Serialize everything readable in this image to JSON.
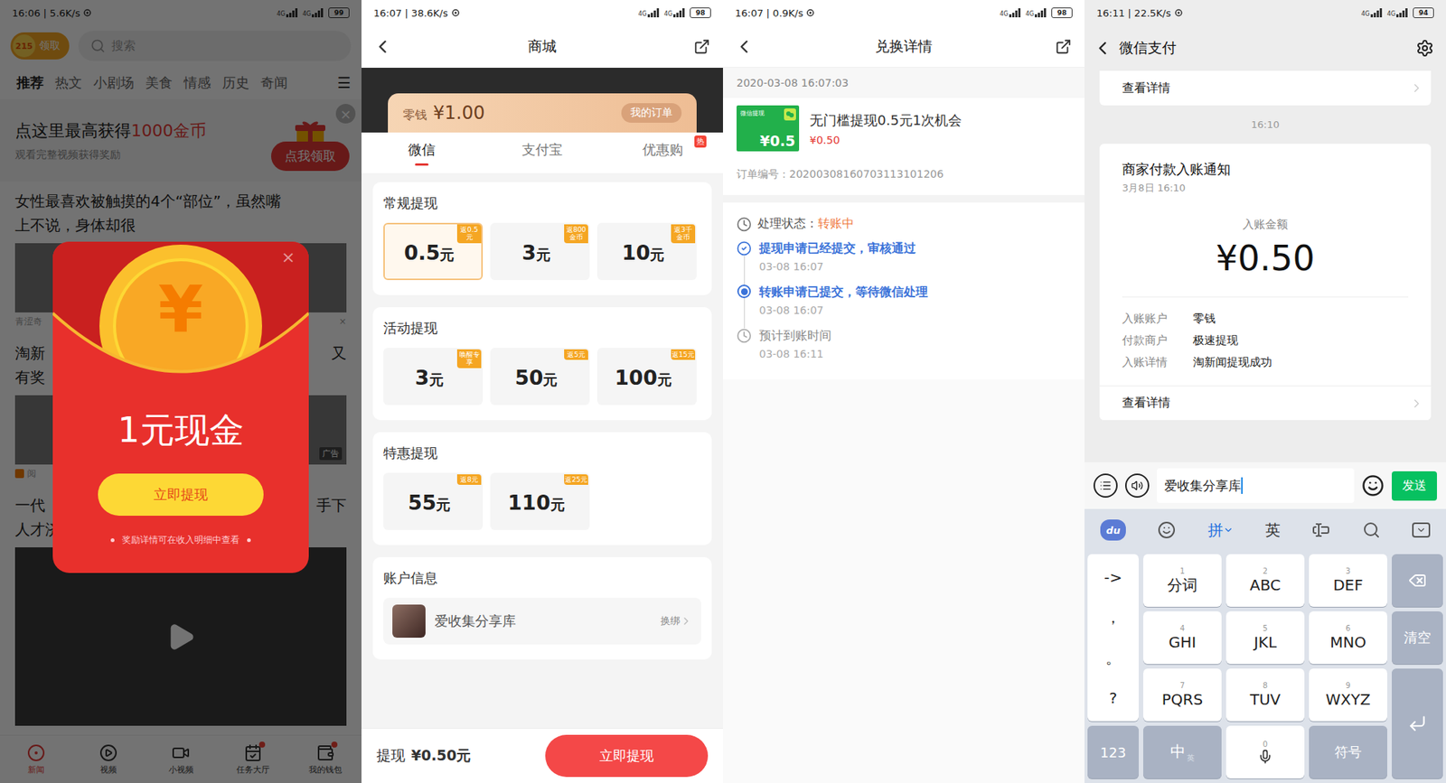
{
  "news_screen": {
    "status": {
      "time": "16:06 | 5.6K/s",
      "network": "4G",
      "battery": "99"
    },
    "coin_badge": {
      "count": "215",
      "label": "领取"
    },
    "search": {
      "placeholder": "搜索"
    },
    "tabs": [
      {
        "label": "推荐",
        "selected": true
      },
      {
        "label": "热文",
        "selected": false
      },
      {
        "label": "小剧场",
        "selected": false
      },
      {
        "label": "美食",
        "selected": false
      },
      {
        "label": "情感",
        "selected": false
      },
      {
        "label": "历史",
        "selected": false
      },
      {
        "label": "奇闻",
        "selected": false
      }
    ],
    "tab_menu": "☰",
    "banner": {
      "title": "点这里最高获得",
      "highlight": "1000金币",
      "subtitle": "观看完整视频获得奖励",
      "button": "点我领取",
      "close": "×"
    },
    "articles": [
      {
        "title_lines": [
          {
            "left": "女性最喜欢被触摸的4个“部位”，虽然嘴",
            "right": ""
          },
          {
            "left": "上不说，身体却很",
            "right": ""
          }
        ],
        "media": "photo",
        "caption": "青涩奇",
        "dismiss": "×",
        "ad": ""
      },
      {
        "title_lines": [
          {
            "left": "淘新",
            "right": "又"
          },
          {
            "left": "有奖",
            "right": ""
          }
        ],
        "media": "photo",
        "caption": "阅",
        "dismiss": "",
        "ad": "广告"
      },
      {
        "title_lines": [
          {
            "left": "一代",
            "right": "手下"
          },
          {
            "left": "人才济济，下秒全军覆没",
            "right": ""
          }
        ],
        "media": "video",
        "caption": "",
        "dismiss": "",
        "ad": ""
      }
    ],
    "bottom_nav": [
      {
        "label": "新闻",
        "selected": true,
        "badge": false
      },
      {
        "label": "视频",
        "selected": false,
        "badge": false
      },
      {
        "label": "小视频",
        "selected": false,
        "badge": false
      },
      {
        "label": "任务大厅",
        "selected": false,
        "badge": true
      },
      {
        "label": "我的钱包",
        "selected": false,
        "badge": true
      }
    ],
    "popup": {
      "coin_symbol": "¥",
      "amount": "1元现金",
      "button": "立即提现",
      "note": "奖励详情可在收入明细中查看",
      "close": "×"
    }
  },
  "mall_screen": {
    "status": {
      "time": "16:07 | 38.6K/s",
      "network": "4G",
      "battery": "98"
    },
    "title": "商城",
    "balance": {
      "label": "零钱",
      "amount": "¥1.00",
      "orders": "我的订单"
    },
    "tabs": [
      {
        "label": "微信",
        "selected": true,
        "badge": ""
      },
      {
        "label": "支付宝",
        "selected": false,
        "badge": ""
      },
      {
        "label": "优惠购",
        "selected": false,
        "badge": "热"
      }
    ],
    "sections": [
      {
        "title": "常规提现",
        "options": [
          {
            "value": "0.5",
            "unit": "元",
            "tag": "返0.5元",
            "selected": true
          },
          {
            "value": "3",
            "unit": "元",
            "tag": "返800金币",
            "selected": false
          },
          {
            "value": "10",
            "unit": "元",
            "tag": "返3千金币",
            "selected": false
          }
        ]
      },
      {
        "title": "活动提现",
        "options": [
          {
            "value": "3",
            "unit": "元",
            "tag": "唤醒专享",
            "selected": false
          },
          {
            "value": "50",
            "unit": "元",
            "tag": "返5元",
            "selected": false
          },
          {
            "value": "100",
            "unit": "元",
            "tag": "返15元",
            "selected": false
          }
        ]
      },
      {
        "title": "特惠提现",
        "options": [
          {
            "value": "55",
            "unit": "元",
            "tag": "返8元",
            "selected": false
          },
          {
            "value": "110",
            "unit": "元",
            "tag": "返25元",
            "selected": false
          }
        ]
      }
    ],
    "account": {
      "title": "账户信息",
      "name": "爱收集分享库",
      "action": "换绑"
    },
    "footer": {
      "label": "提现",
      "amount": "¥0.50元",
      "button": "立即提现"
    }
  },
  "detail_screen": {
    "status": {
      "time": "16:07 | 0.9K/s",
      "network": "4G",
      "battery": "98"
    },
    "title": "兑换详情",
    "date": "2020-03-08 16:07:03",
    "product": {
      "thumb_label": "微信提现",
      "thumb_amount": "¥0.5",
      "title": "无门槛提现0.5元1次机会",
      "price": "¥0.50"
    },
    "order": {
      "label": "订单编号：",
      "value": "20200308160703113101206"
    },
    "status_row": {
      "label": "处理状态：",
      "value": "转账中"
    },
    "steps": [
      {
        "text": "提现申请已经提交，审核通过",
        "time": "03-08 16:07",
        "kind": "done"
      },
      {
        "text": "转账申请已提交，等待微信处理",
        "time": "03-08 16:07",
        "kind": "current"
      },
      {
        "text": "预计到账时间",
        "time": "03-08 16:11",
        "kind": "pending"
      }
    ]
  },
  "wechat_screen": {
    "status": {
      "time": "16:11 | 22.5K/s",
      "network": "4G",
      "battery": "94"
    },
    "title": "微信支付",
    "prev_link": "查看详情",
    "time_divider": "16:10",
    "card": {
      "title": "商家付款入账通知",
      "date": "3月8日 16:10",
      "amount_label": "入账金额",
      "amount": "¥0.50",
      "rows": [
        {
          "label": "入账账户",
          "value": "零钱"
        },
        {
          "label": "付款商户",
          "value": "极速提现"
        },
        {
          "label": "入账详情",
          "value": "淘新闻提现成功"
        }
      ],
      "link": "查看详情"
    },
    "input": {
      "value": "爱收集分享库",
      "send": "发送"
    },
    "keyboard": {
      "logo": "du",
      "modes": [
        {
          "label": "拼",
          "selected": true
        },
        {
          "label": "英",
          "selected": false
        }
      ],
      "side_keys": [
        "->",
        "，",
        "。",
        "?"
      ],
      "letter_keys": [
        {
          "number": "1",
          "label": "分词"
        },
        {
          "number": "2",
          "label": "ABC"
        },
        {
          "number": "3",
          "label": "DEF"
        },
        {
          "number": "4",
          "label": "GHI"
        },
        {
          "number": "5",
          "label": "JKL"
        },
        {
          "number": "6",
          "label": "MNO"
        },
        {
          "number": "7",
          "label": "PQRS"
        },
        {
          "number": "8",
          "label": "TUV"
        },
        {
          "number": "9",
          "label": "WXYZ"
        }
      ],
      "clear_key": "清空",
      "numbers_key": "123",
      "lang_main": "中",
      "lang_alt": "英",
      "space_number": "0",
      "symbols_key": "符号"
    }
  }
}
